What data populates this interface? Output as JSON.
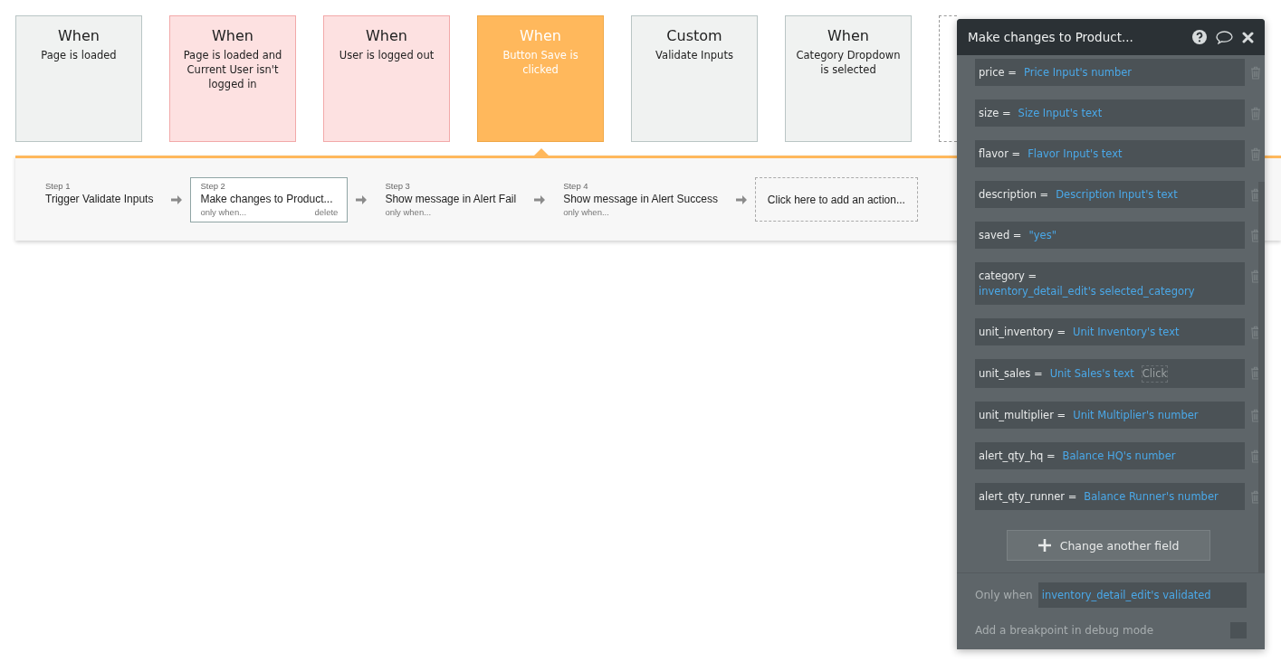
{
  "events": [
    {
      "heading": "When",
      "label": "Page is loaded",
      "color": "#f0f2f1",
      "selected": false
    },
    {
      "heading": "When",
      "label": "Page is loaded and Current User isn't logged in",
      "color": "#fde1e1",
      "selected": false
    },
    {
      "heading": "When",
      "label": "User is logged out",
      "color": "#fde1e1",
      "selected": false
    },
    {
      "heading": "When",
      "label": "Button Save is clicked",
      "color": "#ffb85c",
      "selected": true
    },
    {
      "heading": "Custom",
      "label": "Validate Inputs",
      "color": "#f0f2f1",
      "selected": false
    },
    {
      "heading": "When",
      "label": "Category Dropdown is selected",
      "color": "#f0f2f1",
      "selected": false
    }
  ],
  "steps": [
    {
      "step": "Step 1",
      "title": "Trigger Validate Inputs",
      "selected": false
    },
    {
      "step": "Step 2",
      "title": "Make changes to Product...",
      "condition": "only when...",
      "delete": "delete",
      "selected": true
    },
    {
      "step": "Step 3",
      "title": "Show message in Alert Fail",
      "condition": "only when...",
      "selected": false
    },
    {
      "step": "Step 4",
      "title": "Show message in Alert Success",
      "condition": "only when...",
      "selected": false
    }
  ],
  "add_action": "Click here to add an action...",
  "panel": {
    "title": "Make changes to Product...",
    "fields": [
      {
        "name": "price =",
        "value": "Price Input's number"
      },
      {
        "name": "size =",
        "value": "Size Input's text"
      },
      {
        "name": "flavor =",
        "value": "Flavor Input's text"
      },
      {
        "name": "description =",
        "value": "Description Input's text"
      },
      {
        "name": "saved =",
        "value": "\"yes\""
      },
      {
        "name": "category =",
        "value": "inventory_detail_edit's selected_category"
      },
      {
        "name": "unit_inventory =",
        "value": "Unit Inventory's text"
      },
      {
        "name": "unit_sales =",
        "value": "Unit Sales's text",
        "hint": "Click"
      },
      {
        "name": "unit_multiplier =",
        "value": "Unit Multiplier's number"
      },
      {
        "name": "alert_qty_hq =",
        "value": "Balance HQ's number"
      },
      {
        "name": "alert_qty_runner =",
        "value": "Balance Runner's number"
      }
    ],
    "add_button": "Change another field",
    "only_when_label": "Only when",
    "only_when_value": "inventory_detail_edit's validated",
    "breakpoint_label": "Add a breakpoint in debug mode",
    "breakpoint_checked": false
  }
}
